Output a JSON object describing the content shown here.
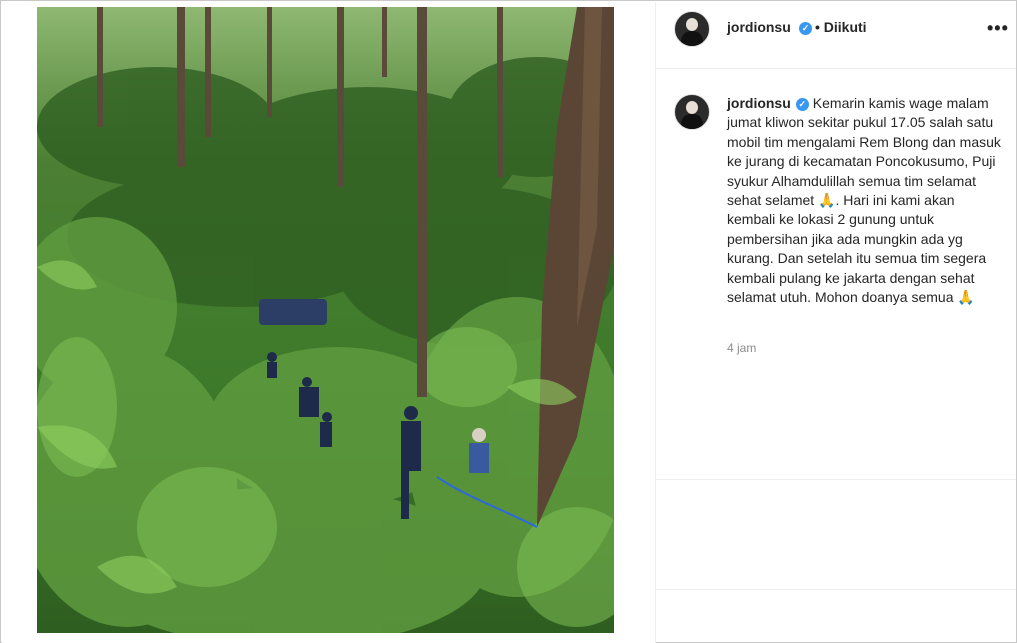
{
  "post": {
    "username": "jordionsu",
    "follow_status": "• Diikuti",
    "more_icon": "more-dots-icon",
    "verified_icon": "verified-badge-icon"
  },
  "caption": {
    "username": "jordionsu",
    "part1": "Kemarin kamis wage malam jumat kliwon sekitar pukul 17.05 salah satu mobil tim mengalami Rem Blong dan masuk ke jurang di kecamatan Poncokusumo, Puji syukur Alhamdulillah semua tim selamat sehat selamet",
    "emoji1": "🙏",
    "part2": ". Hari ini kami akan kembali ke lokasi 2 gunung untuk pembersihan jika ada mungkin ada yg kurang. Dan setelah itu semua tim segera kembali pulang ke jakarta dengan sehat selamat utuh. Mohon doanya semua ",
    "emoji2": "🙏"
  },
  "timestamp": "4 jam",
  "colors": {
    "verified": "#3897f0",
    "text": "#262626",
    "muted": "#8e8e8e"
  }
}
